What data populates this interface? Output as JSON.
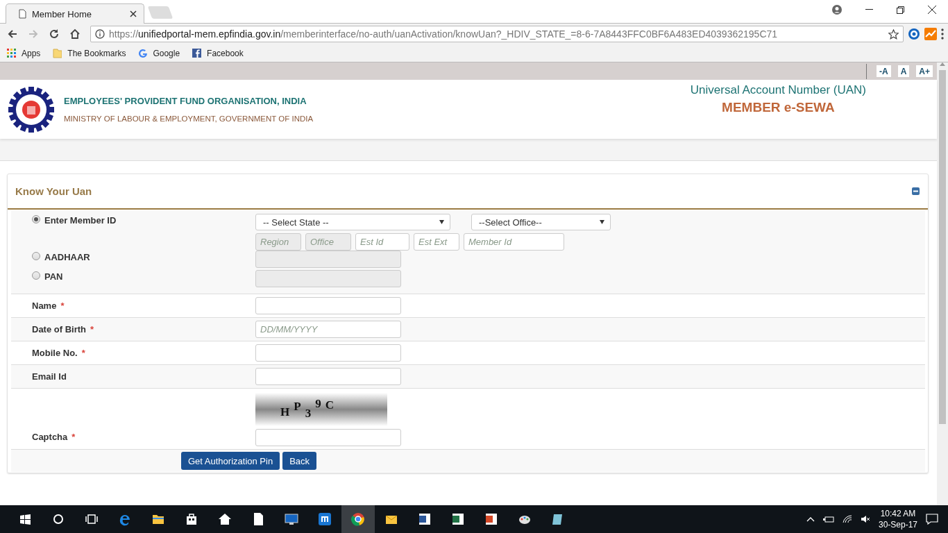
{
  "browser": {
    "tab": {
      "title": "Member Home"
    },
    "url": {
      "scheme": "https://",
      "host": "unifiedportal-mem.epfindia.gov.in",
      "path": "/memberinterface/no-auth/uanActivation/knowUan?_HDIV_STATE_=8-6-7A8443FFC0BF6A483ED4039362195C71"
    },
    "bookmarks": [
      {
        "label": "Apps",
        "kind": "apps"
      },
      {
        "label": "The Bookmarks",
        "kind": "folder"
      },
      {
        "label": "Google",
        "kind": "google"
      },
      {
        "label": "Facebook",
        "kind": "facebook"
      }
    ]
  },
  "font_size_buttons": [
    "-A",
    "A",
    "A+"
  ],
  "header": {
    "org_name": "EMPLOYEES' PROVIDENT FUND ORGANISATION, INDIA",
    "ministry": "MINISTRY OF LABOUR & EMPLOYMENT, GOVERNMENT OF INDIA",
    "uan_title": "Universal Account Number (UAN)",
    "service": "MEMBER e-SEWA"
  },
  "panel": {
    "title": "Know Your Uan",
    "expanded": true
  },
  "id_options": [
    {
      "label": "Enter Member ID",
      "selected": true,
      "kind": "member_id"
    },
    {
      "label": "AADHAAR",
      "selected": false,
      "kind": "text"
    },
    {
      "label": "PAN",
      "selected": false,
      "kind": "text"
    }
  ],
  "member_id": {
    "state_select": "-- Select State --",
    "office_select": "--Select Office--",
    "parts": [
      {
        "placeholder": "Region",
        "disabled": true
      },
      {
        "placeholder": "Office",
        "disabled": true
      },
      {
        "placeholder": "Est Id",
        "disabled": false
      },
      {
        "placeholder": "Est Ext",
        "disabled": false
      },
      {
        "placeholder": "Member Id",
        "disabled": false
      }
    ]
  },
  "fields": [
    {
      "label": "Name",
      "required_mark": "*"
    },
    {
      "label": "Date of Birth",
      "required_mark": "*",
      "placeholder": "DD/MM/YYYY"
    },
    {
      "label": "Mobile No.",
      "required_mark": "*"
    },
    {
      "label": "Email Id"
    }
  ],
  "captcha": {
    "label": "Captcha",
    "required_mark": "*",
    "text": "HP39C"
  },
  "buttons": [
    "Get Authorization Pin",
    "Back"
  ],
  "taskbar": {
    "time": "10:42 AM",
    "date": "30-Sep-17"
  }
}
